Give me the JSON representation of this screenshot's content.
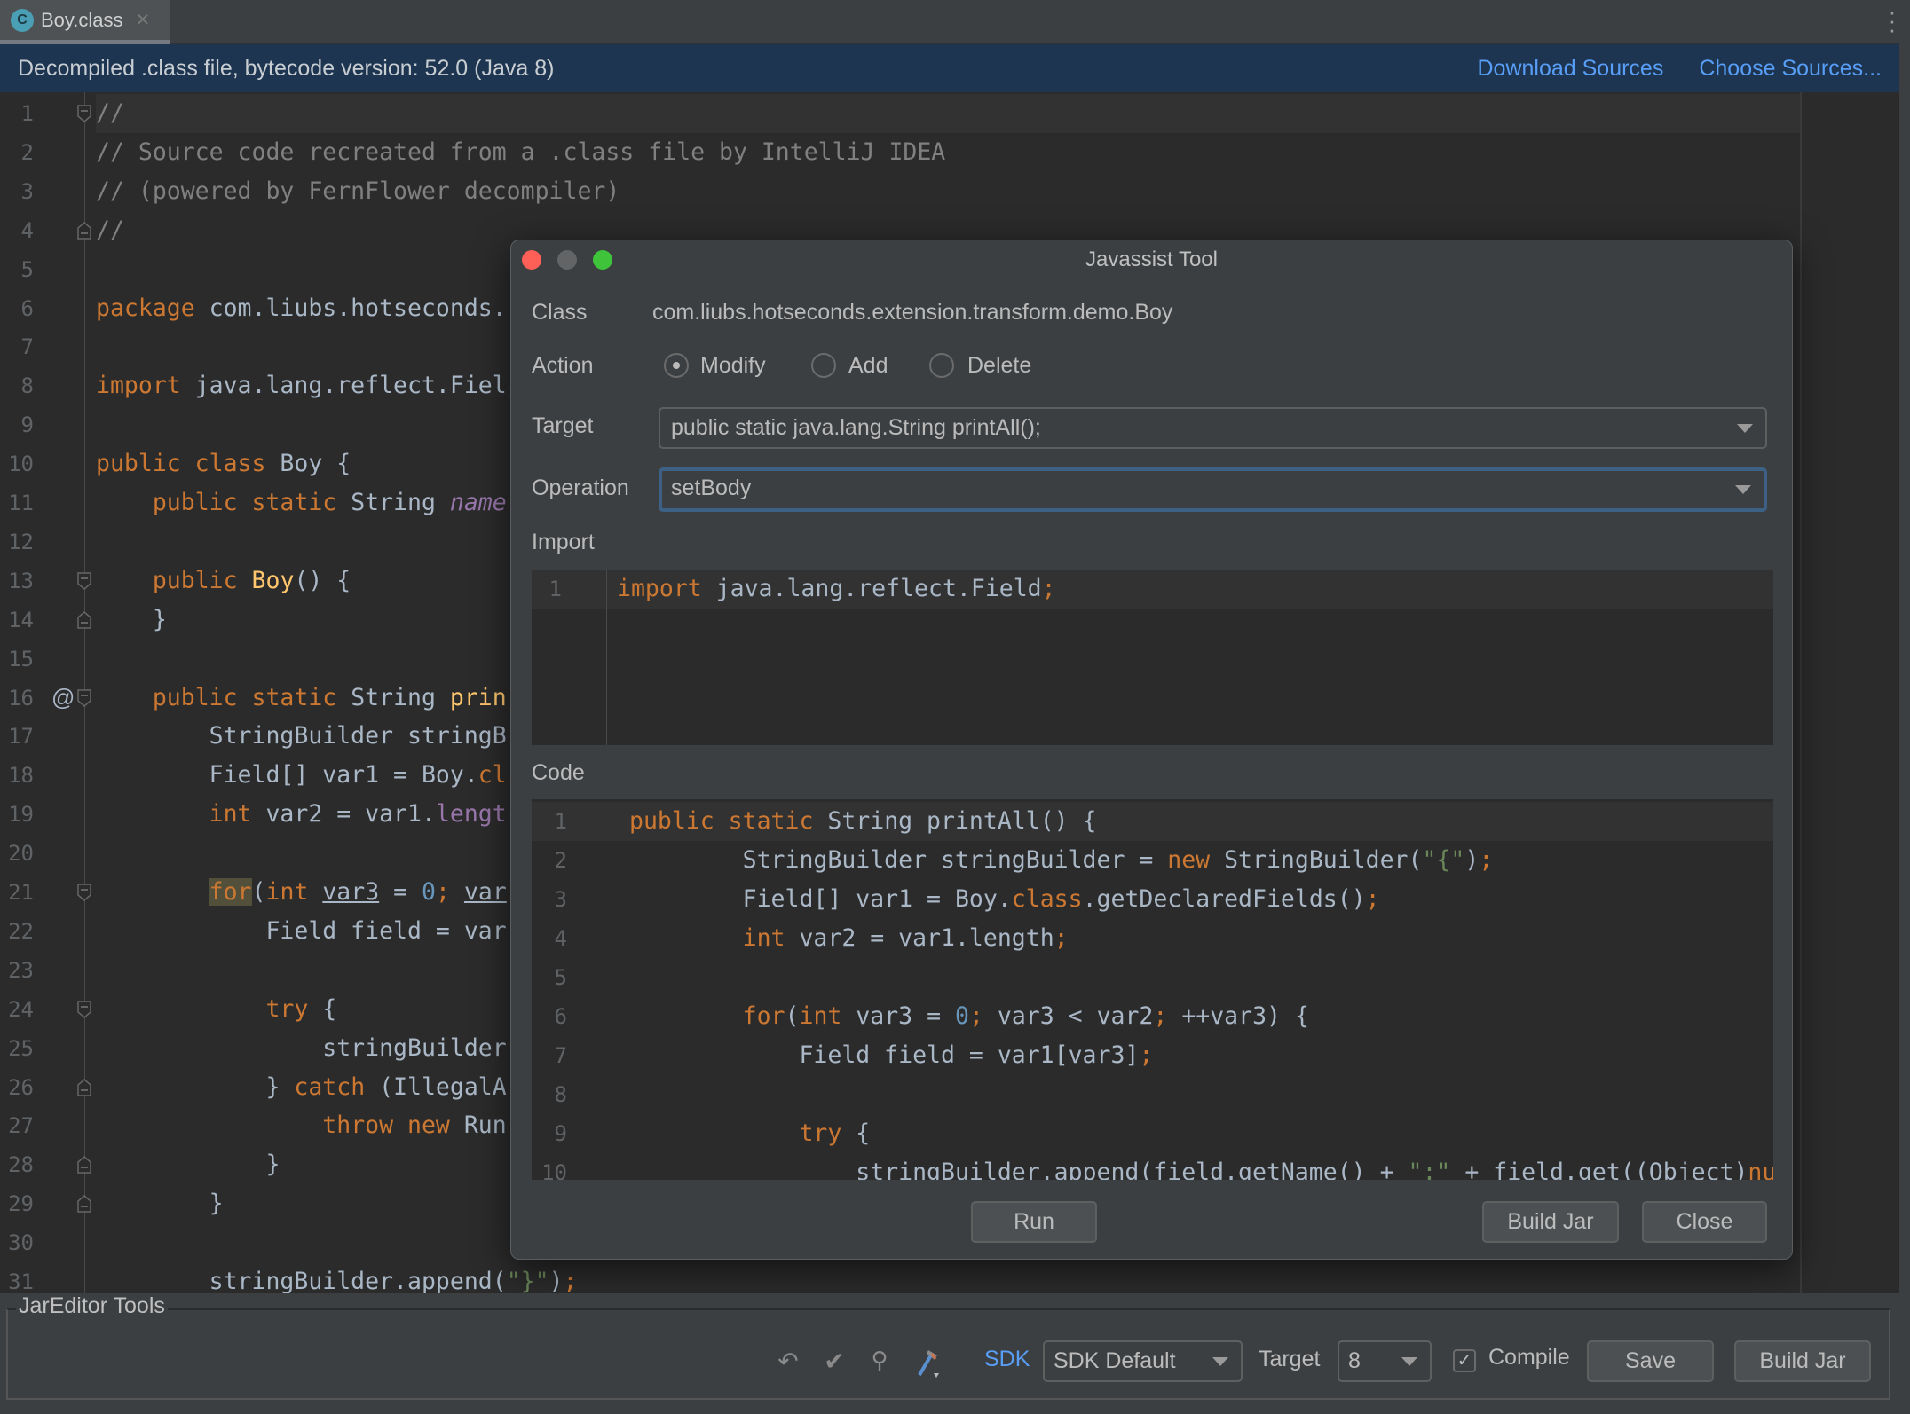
{
  "tab": {
    "icon": "class-c-icon",
    "icon_letter": "C",
    "label": "Boy.class",
    "close": "✕"
  },
  "banner": {
    "text": "Decompiled .class file, bytecode version: 52.0 (Java 8)",
    "download": "Download Sources",
    "choose": "Choose Sources..."
  },
  "editor": {
    "override_marker": "@",
    "lines": [
      [
        [
          "//",
          "cm"
        ]
      ],
      [
        [
          "// Source code recreated from a .class file by IntelliJ IDEA",
          "cm"
        ]
      ],
      [
        [
          "// (powered by FernFlower decompiler)",
          "cm"
        ]
      ],
      [
        [
          "//",
          "cm"
        ]
      ],
      [],
      [
        [
          "package",
          "kw"
        ],
        [
          " com.liubs.hotseconds.",
          ""
        ]
      ],
      [],
      [
        [
          "import",
          "kw"
        ],
        [
          " java.lang.reflect.Fiel",
          ""
        ]
      ],
      [],
      [
        [
          "public class",
          "kw"
        ],
        [
          " Boy {",
          ""
        ]
      ],
      [
        [
          "    ",
          ""
        ],
        [
          "public static",
          "kw"
        ],
        [
          " String ",
          ""
        ],
        [
          "name",
          "field"
        ]
      ],
      [],
      [
        [
          "    ",
          ""
        ],
        [
          "public",
          "kw"
        ],
        [
          " ",
          ""
        ],
        [
          "Boy",
          "fn"
        ],
        [
          "() {",
          ""
        ]
      ],
      [
        [
          "    }",
          ""
        ]
      ],
      [],
      [
        [
          "    ",
          ""
        ],
        [
          "public static",
          "kw"
        ],
        [
          " String ",
          ""
        ],
        [
          "prin",
          "fn"
        ]
      ],
      [
        [
          "        StringBuilder stringB",
          ""
        ]
      ],
      [
        [
          "        Field[] var1 = Boy.",
          ""
        ],
        [
          "cl",
          "kw"
        ]
      ],
      [
        [
          "        ",
          ""
        ],
        [
          "int",
          "kw"
        ],
        [
          " var2 = var1.",
          ""
        ],
        [
          "lengt",
          "prop"
        ]
      ],
      [],
      [
        [
          "        ",
          ""
        ],
        [
          "for",
          "kw hl"
        ],
        [
          "(",
          ""
        ],
        [
          "int",
          "kw"
        ],
        [
          " ",
          ""
        ],
        [
          "var3",
          "u"
        ],
        [
          " = ",
          ""
        ],
        [
          "0",
          "num"
        ],
        [
          ";",
          "kw"
        ],
        [
          " ",
          ""
        ],
        [
          "var",
          "u"
        ]
      ],
      [
        [
          "            Field field = var",
          ""
        ]
      ],
      [],
      [
        [
          "            ",
          ""
        ],
        [
          "try",
          "kw"
        ],
        [
          " {",
          ""
        ]
      ],
      [
        [
          "                stringBuilder",
          ""
        ]
      ],
      [
        [
          "            } ",
          ""
        ],
        [
          "catch",
          "kw"
        ],
        [
          " (IllegalA",
          ""
        ]
      ],
      [
        [
          "                ",
          ""
        ],
        [
          "throw new",
          "kw"
        ],
        [
          " Run",
          ""
        ]
      ],
      [
        [
          "            }",
          ""
        ]
      ],
      [
        [
          "        }",
          ""
        ]
      ],
      [],
      [
        [
          "        stringBuilder.append(",
          ""
        ],
        [
          "\"}\"",
          "str"
        ],
        [
          ")",
          ""
        ],
        [
          ";",
          "kw"
        ]
      ]
    ]
  },
  "dialog": {
    "title": "Javassist Tool",
    "class_label": "Class",
    "class_value": "com.liubs.hotseconds.extension.transform.demo.Boy",
    "action_label": "Action",
    "actions": [
      {
        "label": "Modify",
        "selected": true
      },
      {
        "label": "Add",
        "selected": false
      },
      {
        "label": "Delete",
        "selected": false
      }
    ],
    "target_label": "Target",
    "target_value": "public static java.lang.String printAll();",
    "operation_label": "Operation",
    "operation_value": "setBody",
    "import_label": "Import",
    "import_lines": [
      [
        [
          "import",
          "kw"
        ],
        [
          " java.lang.reflect.Field",
          ""
        ],
        [
          ";",
          "kw"
        ]
      ]
    ],
    "code_label": "Code",
    "code_lines": [
      [
        [
          "public static",
          "kw"
        ],
        [
          " String printAll() {",
          ""
        ]
      ],
      [
        [
          "        StringBuilder stringBuilder = ",
          ""
        ],
        [
          "new",
          "kw"
        ],
        [
          " StringBuilder(",
          ""
        ],
        [
          "\"{\"",
          "str"
        ],
        [
          ")",
          ""
        ],
        [
          ";",
          "kw"
        ]
      ],
      [
        [
          "        Field[] var1 = Boy.",
          ""
        ],
        [
          "class",
          "kw"
        ],
        [
          ".getDeclaredFields()",
          ""
        ],
        [
          ";",
          "kw"
        ]
      ],
      [
        [
          "        ",
          ""
        ],
        [
          "int",
          "kw"
        ],
        [
          " var2 = var1.length",
          ""
        ],
        [
          ";",
          "kw"
        ]
      ],
      [],
      [
        [
          "        ",
          ""
        ],
        [
          "for",
          "kw"
        ],
        [
          "(",
          ""
        ],
        [
          "int",
          "kw"
        ],
        [
          " var3 = ",
          ""
        ],
        [
          "0",
          "num"
        ],
        [
          ";",
          "kw"
        ],
        [
          " var3 < var2",
          ""
        ],
        [
          ";",
          "kw"
        ],
        [
          " ++var3) {",
          ""
        ]
      ],
      [
        [
          "            Field field = var1[var3]",
          ""
        ],
        [
          ";",
          "kw"
        ]
      ],
      [],
      [
        [
          "            ",
          ""
        ],
        [
          "try",
          "kw"
        ],
        [
          " {",
          ""
        ]
      ],
      [
        [
          "                stringBuilder.append(field.getName() + ",
          ""
        ],
        [
          "\":\"",
          "str"
        ],
        [
          " + field.get((Object)",
          ""
        ],
        [
          "nu",
          "kw"
        ]
      ]
    ],
    "buttons": {
      "run": "Run",
      "build_jar": "Build Jar",
      "close": "Close"
    }
  },
  "bottom": {
    "group_label": "JarEditor Tools",
    "icons": [
      "undo-icon",
      "check-icon",
      "search-icon",
      "build-hammer-icon"
    ],
    "sdk_label": "SDK",
    "sdk_value": "SDK Default",
    "target_label": "Target",
    "target_value": "8",
    "compile_label": "Compile",
    "compile_checked": true,
    "save": "Save",
    "build_jar": "Build Jar"
  },
  "colors": {
    "keyword": "#cc7832",
    "string": "#6a8759",
    "number": "#6897bb",
    "method": "#ffc66d",
    "field": "#9876aa",
    "comment": "#808080",
    "link": "#589df6",
    "banner": "#1d3551"
  }
}
